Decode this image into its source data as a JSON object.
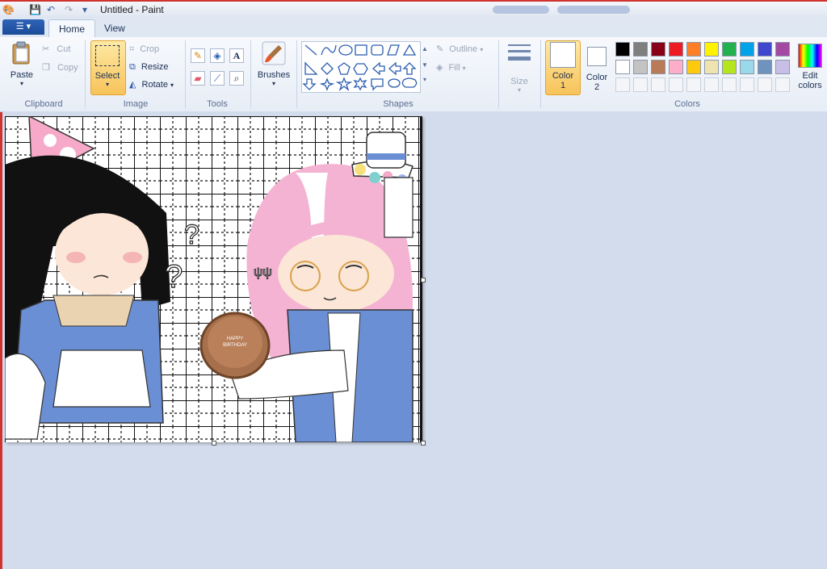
{
  "window": {
    "title": "Untitled - Paint"
  },
  "tabs": {
    "file_icon": "file-menu-icon",
    "home": "Home",
    "view": "View"
  },
  "clipboard": {
    "paste": "Paste",
    "cut": "Cut",
    "copy": "Copy",
    "label": "Clipboard"
  },
  "image": {
    "select": "Select",
    "crop": "Crop",
    "resize": "Resize",
    "rotate": "Rotate",
    "label": "Image"
  },
  "tools": {
    "label": "Tools",
    "items": [
      "pencil-icon",
      "fill-bucket-icon",
      "text-icon",
      "eraser-icon",
      "color-picker-icon",
      "magnifier-icon"
    ]
  },
  "brushes": {
    "label": "Brushes"
  },
  "shapes": {
    "label": "Shapes",
    "outline": "Outline",
    "fill": "Fill"
  },
  "size": {
    "label": "Size"
  },
  "colors": {
    "color1": "Color",
    "color1_num": "1",
    "color2": "Color",
    "color2_num": "2",
    "label": "Colors",
    "edit": "Edit",
    "edit2": "colors",
    "row1": [
      "#000000",
      "#7f7f7f",
      "#880015",
      "#ed1c24",
      "#ff7f27",
      "#fff200",
      "#22b14c",
      "#00a2e8",
      "#3f48cc",
      "#a349a4"
    ],
    "row2": [
      "#ffffff",
      "#c3c3c3",
      "#b97a57",
      "#ffaec9",
      "#ffc90e",
      "#efe4b0",
      "#b5e61d",
      "#99d9ea",
      "#7092be",
      "#c8bfe7"
    ]
  },
  "canvas": {
    "cake_text1": "HAPPY",
    "cake_text2": "BIRTHDAY"
  }
}
